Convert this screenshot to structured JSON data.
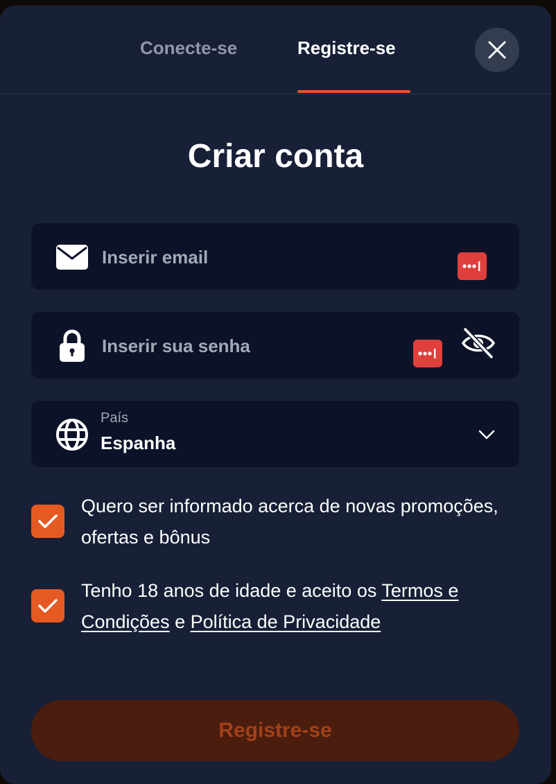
{
  "tabs": {
    "login": "Conecte-se",
    "register": "Registre-se",
    "active": "register"
  },
  "title": "Criar conta",
  "email": {
    "placeholder": "Inserir email",
    "value": ""
  },
  "password": {
    "placeholder": "Inserir sua senha",
    "value": ""
  },
  "country": {
    "label": "País",
    "value": "Espanha"
  },
  "consents": {
    "promo": {
      "text": "Quero ser informado acerca de novas promoções, ofertas e bônus",
      "checked": true
    },
    "terms": {
      "prefix": "Tenho 18 anos de idade e aceito os ",
      "terms_link": "Termos e Condições",
      "middle": " e ",
      "privacy_link": "Política de Privacidade",
      "checked": true
    }
  },
  "submit_label": "Registre-se",
  "colors": {
    "modal_bg": "#172036",
    "field_bg": "#0c1328",
    "accent": "#e55a22",
    "submit_disabled_bg": "#4a1d0e",
    "password_manager_badge": "#e0403c"
  },
  "icons": {
    "close": "close-icon",
    "email": "envelope-icon",
    "password": "lock-icon",
    "visibility": "eye-off-icon",
    "country": "globe-icon",
    "dropdown": "chevron-down-icon",
    "password_manager": "password-manager-icon",
    "checkbox": "checkmark-icon"
  }
}
